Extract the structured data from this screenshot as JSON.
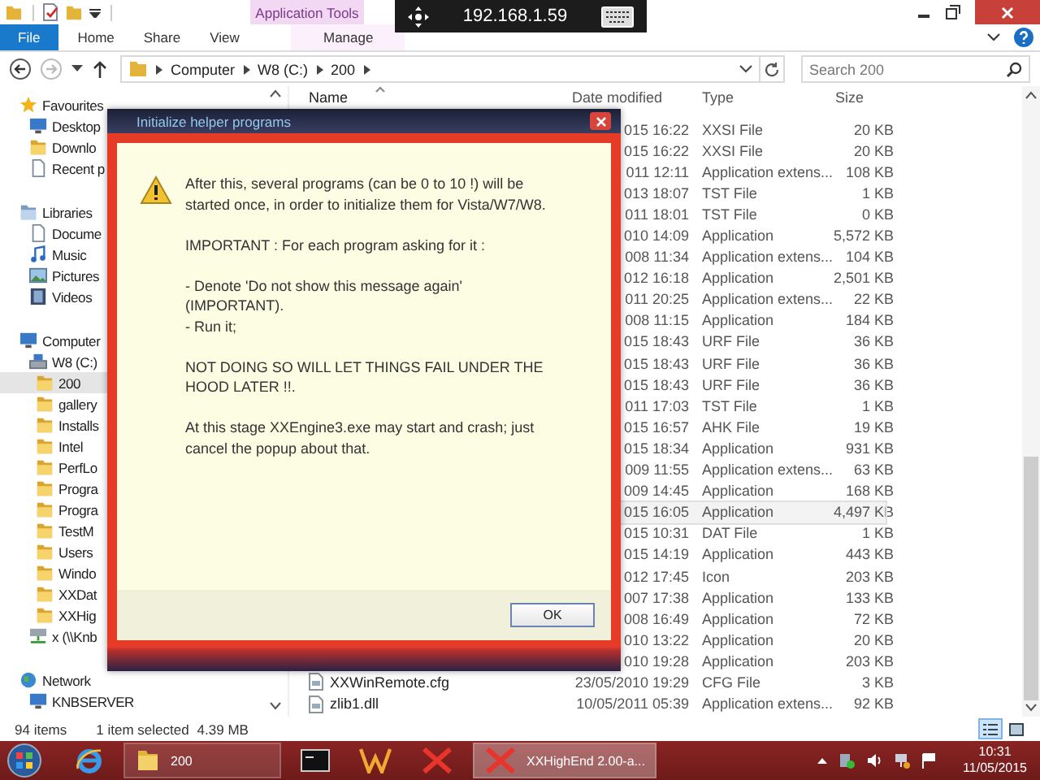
{
  "titlebar": {
    "context_tab": "Application Tools"
  },
  "remote_toolbar": {
    "address": "192.168.1.59"
  },
  "ribbon_tabs": [
    {
      "label": "File",
      "kind": "file"
    },
    {
      "label": "Home",
      "kind": "tab"
    },
    {
      "label": "Share",
      "kind": "tab"
    },
    {
      "label": "View",
      "kind": "tab"
    },
    {
      "label": "Manage",
      "kind": "context"
    }
  ],
  "address_bar": {
    "crumbs": [
      "Computer",
      "W8 (C:)",
      "200"
    ],
    "search_placeholder": "Search 200"
  },
  "sidebar": {
    "groups": [
      {
        "label": "Favourites",
        "kind": "star",
        "selected": false,
        "children": [
          {
            "label": "Desktop",
            "kind": "monitor",
            "selected": false
          },
          {
            "label": "Downlo",
            "kind": "folder",
            "selected": false
          },
          {
            "label": "Recent p",
            "kind": "document",
            "selected": false
          }
        ]
      },
      {
        "label": "Libraries",
        "kind": "library",
        "selected": false,
        "children": [
          {
            "label": "Docume",
            "kind": "document",
            "selected": false
          },
          {
            "label": "Music",
            "kind": "note",
            "selected": false
          },
          {
            "label": "Pictures",
            "kind": "picture",
            "selected": false
          },
          {
            "label": "Videos",
            "kind": "film",
            "selected": false
          }
        ]
      },
      {
        "label": "Computer",
        "kind": "monitor",
        "selected": false,
        "children": [
          {
            "label": "W8 (C:)",
            "kind": "drive",
            "selected": false,
            "children": [
              {
                "label": "200",
                "kind": "folder",
                "selected": true
              },
              {
                "label": "gallery",
                "kind": "folder",
                "selected": false
              },
              {
                "label": "Installs",
                "kind": "folder",
                "selected": false
              },
              {
                "label": "Intel",
                "kind": "folder",
                "selected": false
              },
              {
                "label": "PerfLo",
                "kind": "folder",
                "selected": false
              },
              {
                "label": "Progra",
                "kind": "folder",
                "selected": false
              },
              {
                "label": "Progra",
                "kind": "folder",
                "selected": false
              },
              {
                "label": "TestM",
                "kind": "folder",
                "selected": false
              },
              {
                "label": "Users",
                "kind": "folder",
                "selected": false
              },
              {
                "label": "Windo",
                "kind": "folder",
                "selected": false
              },
              {
                "label": "XXDat",
                "kind": "folder",
                "selected": false
              },
              {
                "label": "XXHig",
                "kind": "folder",
                "selected": false
              }
            ]
          },
          {
            "label": "x (\\\\Knb",
            "kind": "netdrive",
            "selected": false
          }
        ]
      },
      {
        "label": "Network",
        "kind": "globe",
        "selected": false,
        "children": [
          {
            "label": "KNBSERVER",
            "kind": "monitor",
            "selected": false
          }
        ]
      }
    ]
  },
  "file_list": {
    "columns": [
      "Name",
      "Date modified",
      "Type",
      "Size"
    ],
    "rows": [
      {
        "date": "015 16:22",
        "type": "XXSI File",
        "size": "20 KB",
        "selected": false
      },
      {
        "date": "015 16:22",
        "type": "XXSI File",
        "size": "20 KB",
        "selected": false
      },
      {
        "date": "011 12:11",
        "type": "Application extens...",
        "size": "108 KB",
        "selected": false
      },
      {
        "date": "013 18:07",
        "type": "TST File",
        "size": "1 KB",
        "selected": false
      },
      {
        "date": "011 18:01",
        "type": "TST File",
        "size": "0 KB",
        "selected": false
      },
      {
        "date": "010 14:09",
        "type": "Application",
        "size": "5,572 KB",
        "selected": false
      },
      {
        "date": "008 11:34",
        "type": "Application extens...",
        "size": "104 KB",
        "selected": false
      },
      {
        "date": "012 16:18",
        "type": "Application",
        "size": "2,501 KB",
        "selected": false
      },
      {
        "date": "011 20:25",
        "type": "Application extens...",
        "size": "22 KB",
        "selected": false
      },
      {
        "date": "008 11:15",
        "type": "Application",
        "size": "184 KB",
        "selected": false
      },
      {
        "date": "015 18:43",
        "type": "URF File",
        "size": "36 KB",
        "selected": false
      },
      {
        "date": "015 18:43",
        "type": "URF File",
        "size": "36 KB",
        "selected": false
      },
      {
        "date": "015 18:43",
        "type": "URF File",
        "size": "36 KB",
        "selected": false
      },
      {
        "date": "011 17:03",
        "type": "TST File",
        "size": "1 KB",
        "selected": false
      },
      {
        "date": "015 16:57",
        "type": "AHK File",
        "size": "19 KB",
        "selected": false
      },
      {
        "date": "015 18:34",
        "type": "Application",
        "size": "931 KB",
        "selected": false
      },
      {
        "date": "009 11:55",
        "type": "Application extens...",
        "size": "63 KB",
        "selected": false
      },
      {
        "date": "009 14:45",
        "type": "Application",
        "size": "168 KB",
        "selected": false
      },
      {
        "date": "015 16:05",
        "type": "Application",
        "size": "4,497 KB",
        "selected": true
      },
      {
        "date": "015 10:31",
        "type": "DAT File",
        "size": "1 KB",
        "selected": false
      },
      {
        "date": "015 14:19",
        "type": "Application",
        "size": "443 KB",
        "selected": false
      },
      {
        "date": "012 17:45",
        "type": "Icon",
        "size": "203 KB",
        "selected": false
      },
      {
        "date": "007 17:38",
        "type": "Application",
        "size": "133 KB",
        "selected": false
      },
      {
        "date": "008 16:49",
        "type": "Application",
        "size": "72 KB",
        "selected": false
      },
      {
        "date": "010 13:22",
        "type": "Application",
        "size": "20 KB",
        "selected": false
      },
      {
        "date": "010 19:28",
        "type": "Application",
        "size": "203 KB",
        "selected": false
      },
      {
        "name": "XXWinRemote.cfg",
        "date": "23/05/2010 19:29",
        "type": "CFG File",
        "size": "3 KB",
        "selected": false
      },
      {
        "name": "zlib1.dll",
        "date": "10/05/2011 05:39",
        "type": "Application extens...",
        "size": "92 KB",
        "selected": false
      }
    ]
  },
  "status_bar": {
    "count": "94 items",
    "selection": "1 item selected",
    "selection_size": "4.39 MB"
  },
  "dialog": {
    "title": "Initialize helper programs",
    "paragraphs": [
      "After this, several programs (can be 0 to 10 !) will be\nstarted once, in order to initialize them for Vista/W7/W8.",
      "IMPORTANT : For each program asking for it :",
      "- Denote 'Do not show this message again'\n(IMPORTANT).\n- Run it;",
      "NOT DOING SO WILL LET THINGS FAIL UNDER THE\nHOOD LATER !!.",
      "At this stage XXEngine3.exe may start and crash; just\ncancel the popup about that."
    ],
    "button": "OK"
  },
  "taskbar": {
    "apps": [
      {
        "kind": "ie",
        "selected": false
      },
      {
        "kind": "explorer",
        "label": "200",
        "selected": false
      },
      {
        "kind": "console",
        "selected": false
      },
      {
        "kind": "w-app",
        "selected": false
      },
      {
        "kind": "x-app",
        "selected": false
      },
      {
        "kind": "x-app",
        "label": "XXHighEnd 2.00-a...",
        "selected": true
      }
    ],
    "time": "10:31",
    "date": "11/05/2015"
  }
}
